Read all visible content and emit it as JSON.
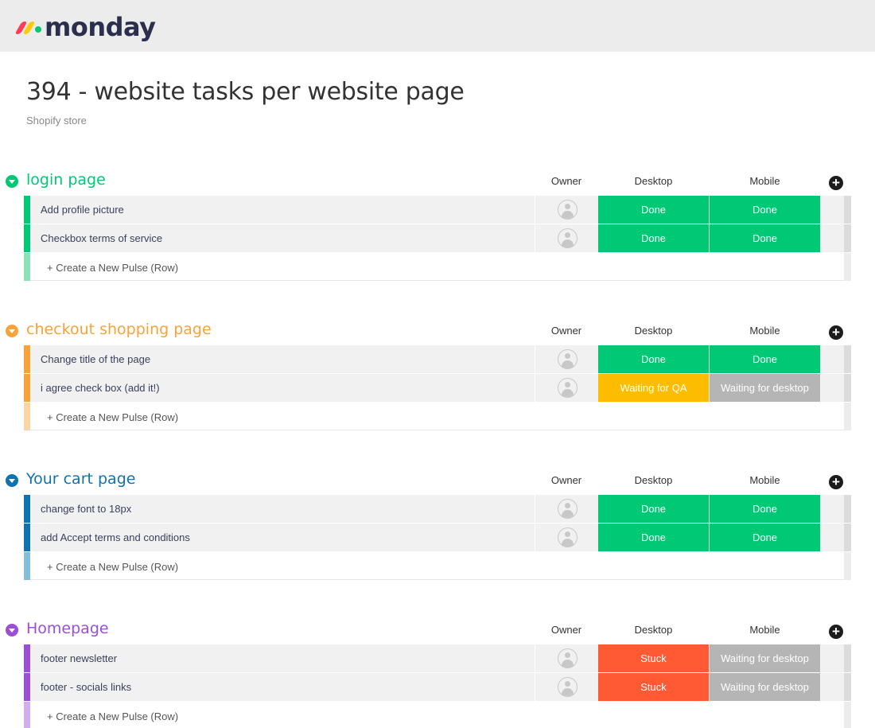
{
  "app": {
    "logo_text": "monday",
    "logo_colors": [
      "#ff3d57",
      "#ffcb00",
      "#00ca72"
    ]
  },
  "board": {
    "title": "394 - website tasks per website page",
    "subtitle": "Shopify store"
  },
  "columns": {
    "owner": "Owner",
    "desktop": "Desktop",
    "mobile": "Mobile"
  },
  "create_label": "+ Create a New Pulse (Row)",
  "status_colors": {
    "Done": "#00c875",
    "Waiting for QA": "#fdbc00",
    "Waiting for desktop": "#b5b5b5",
    "Stuck": "#ff5a33"
  },
  "groups": [
    {
      "name": "login page",
      "color": "#00c875",
      "light_color": "#8ee0b8",
      "rows": [
        {
          "name": "Add profile picture",
          "desktop": "Done",
          "mobile": "Done"
        },
        {
          "name": "Checkbox terms of service",
          "desktop": "Done",
          "mobile": "Done"
        }
      ]
    },
    {
      "name": "checkout shopping page",
      "color": "#f7a33a",
      "light_color": "#fcd5a6",
      "rows": [
        {
          "name": "Change title of the page",
          "desktop": "Done",
          "mobile": "Done"
        },
        {
          "name": "i agree check box (add it!)",
          "desktop": "Waiting for QA",
          "mobile": "Waiting for desktop"
        }
      ]
    },
    {
      "name": "Your cart page",
      "color": "#0f73b0",
      "light_color": "#86bddc",
      "rows": [
        {
          "name": "change font to 18px",
          "desktop": "Done",
          "mobile": "Done"
        },
        {
          "name": "add Accept terms and conditions",
          "desktop": "Done",
          "mobile": "Done"
        }
      ]
    },
    {
      "name": "Homepage",
      "color": "#9b4fd3",
      "light_color": "#d1afea",
      "rows": [
        {
          "name": "footer newsletter",
          "desktop": "Stuck",
          "mobile": "Waiting for desktop"
        },
        {
          "name": "footer - socials links",
          "desktop": "Stuck",
          "mobile": "Waiting for desktop"
        }
      ]
    }
  ]
}
